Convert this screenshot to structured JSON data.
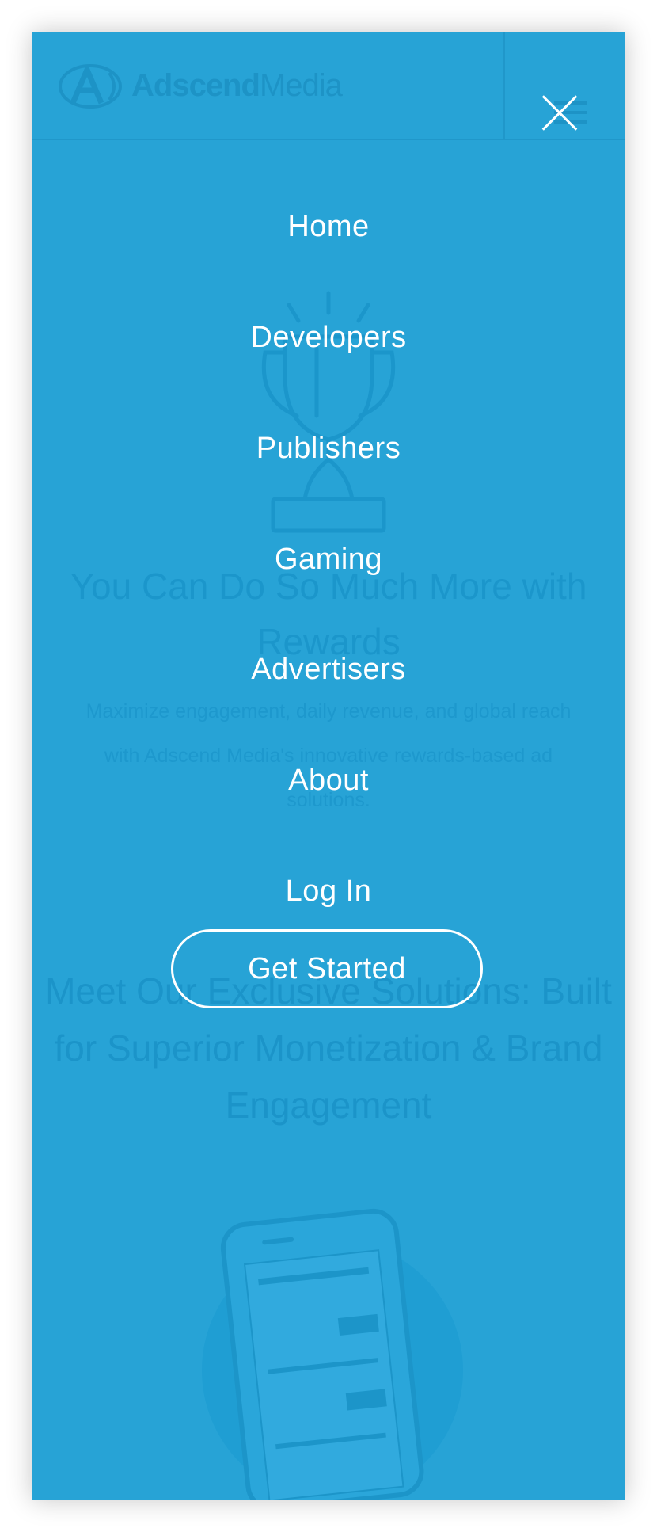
{
  "brand": {
    "name_bold": "Adscend",
    "name_light": "Media",
    "mark_letter": "A"
  },
  "hero": {
    "title": "You Can Do So Much More with Rewards",
    "subtitle": "Maximize engagement, daily revenue, and global reach with Adscend Media's innovative rewards-based ad solutions."
  },
  "solutions": {
    "title": "Meet Our Exclusive Solutions: Built for Superior Monetization & Brand Engagement"
  },
  "menu": {
    "items": [
      {
        "label": "Home"
      },
      {
        "label": "Developers"
      },
      {
        "label": "Publishers"
      },
      {
        "label": "Gaming"
      },
      {
        "label": "Advertisers"
      },
      {
        "label": "About"
      },
      {
        "label": "Log In"
      }
    ],
    "cta_label": "Get Started"
  },
  "colors": {
    "overlay": "#27a3d6",
    "text": "#ffffff",
    "faded_text": "#1b96cb"
  },
  "icons": [
    "close-icon",
    "trophy-icon",
    "logo-mark-icon",
    "hamburger-icon",
    "phone-illustration"
  ]
}
